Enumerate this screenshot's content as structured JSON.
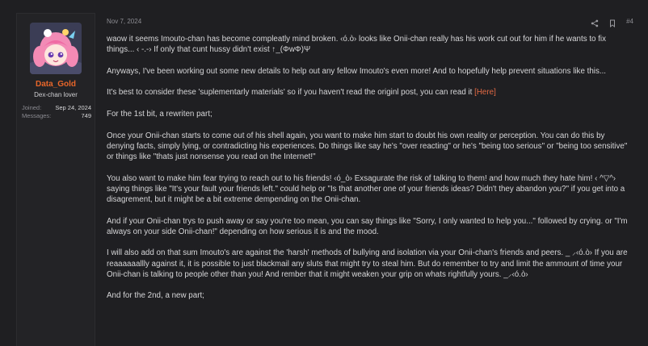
{
  "user": {
    "name": "Data_Gold",
    "title": "Dex-chan lover",
    "stats": [
      {
        "label": "Joined:",
        "value": "Sep 24, 2024"
      },
      {
        "label": "Messages:",
        "value": "749"
      }
    ]
  },
  "post": {
    "date": "Nov 7, 2024",
    "number": "#4",
    "icons": [
      "share-icon",
      "bookmark-icon"
    ],
    "link_text": "[Here]",
    "paragraphs": [
      "waow it seems Imouto-chan has become compleatly mind broken. ‹ó.ò› looks like Onii-chan really has his work cut out for him if he wants to fix things... ‹ -.-› If only that cunt hussy didn't exist ↑_(ΦwΦ)Ψ",
      "Anyways, I've been working out some new details to help out any fellow Imouto's even more! And to hopefully help prevent situations like this...",
      "It's best to consider these 'suplementarly materials' so if you haven't read the originl post, you can read it",
      "For the 1st bit, a rewriten part;",
      "Once your Onii-chan starts to come out of his shell again, you want to make him start to doubt his own reality or perception. You can do this by denying facts, simply lying, or contradicting his experiences. Do things like say he's \"over reacting\" or he's \"being too serious\" or \"being too sensitive\" or things like \"thats just nonsense you read on the Internet!\"",
      "You also want to make him fear trying to reach out to his friends! ‹ó_ò› Exsagurate the risk of talking to them! and how much they hate him! ‹ ^▽^› saying things like \"It's your fault your friends left.\" could help or \"Is that another one of your friends ideas? Didn't they abandon you?\" if you get into a disagrement, but it might be a bit extreme dempending on the Onii-chan.",
      "And if your Onii-chan trys to push away or say you're too mean, you can say things like \"Sorry, I only wanted to help you...\" followed by crying. or \"I'm always on your side Onii-chan!\" depending on how serious it is and the mood.",
      "I will also add on that sum Imouto's are against the 'harsh' methods of bullying and isolation via your Onii-chan's friends and peers. _ ⸝‹ó.ò› If you are reaaaaaallly against it, it is possible to just blackmail any sluts that might try to steal him. But do remember to try and limit the ammount of time your Onii-chan is talking to people other than you! And rember that it might weaken your grip on whats rightfully yours. _⸝‹ó.ò›",
      "And for the 2nd, a new part;"
    ]
  }
}
